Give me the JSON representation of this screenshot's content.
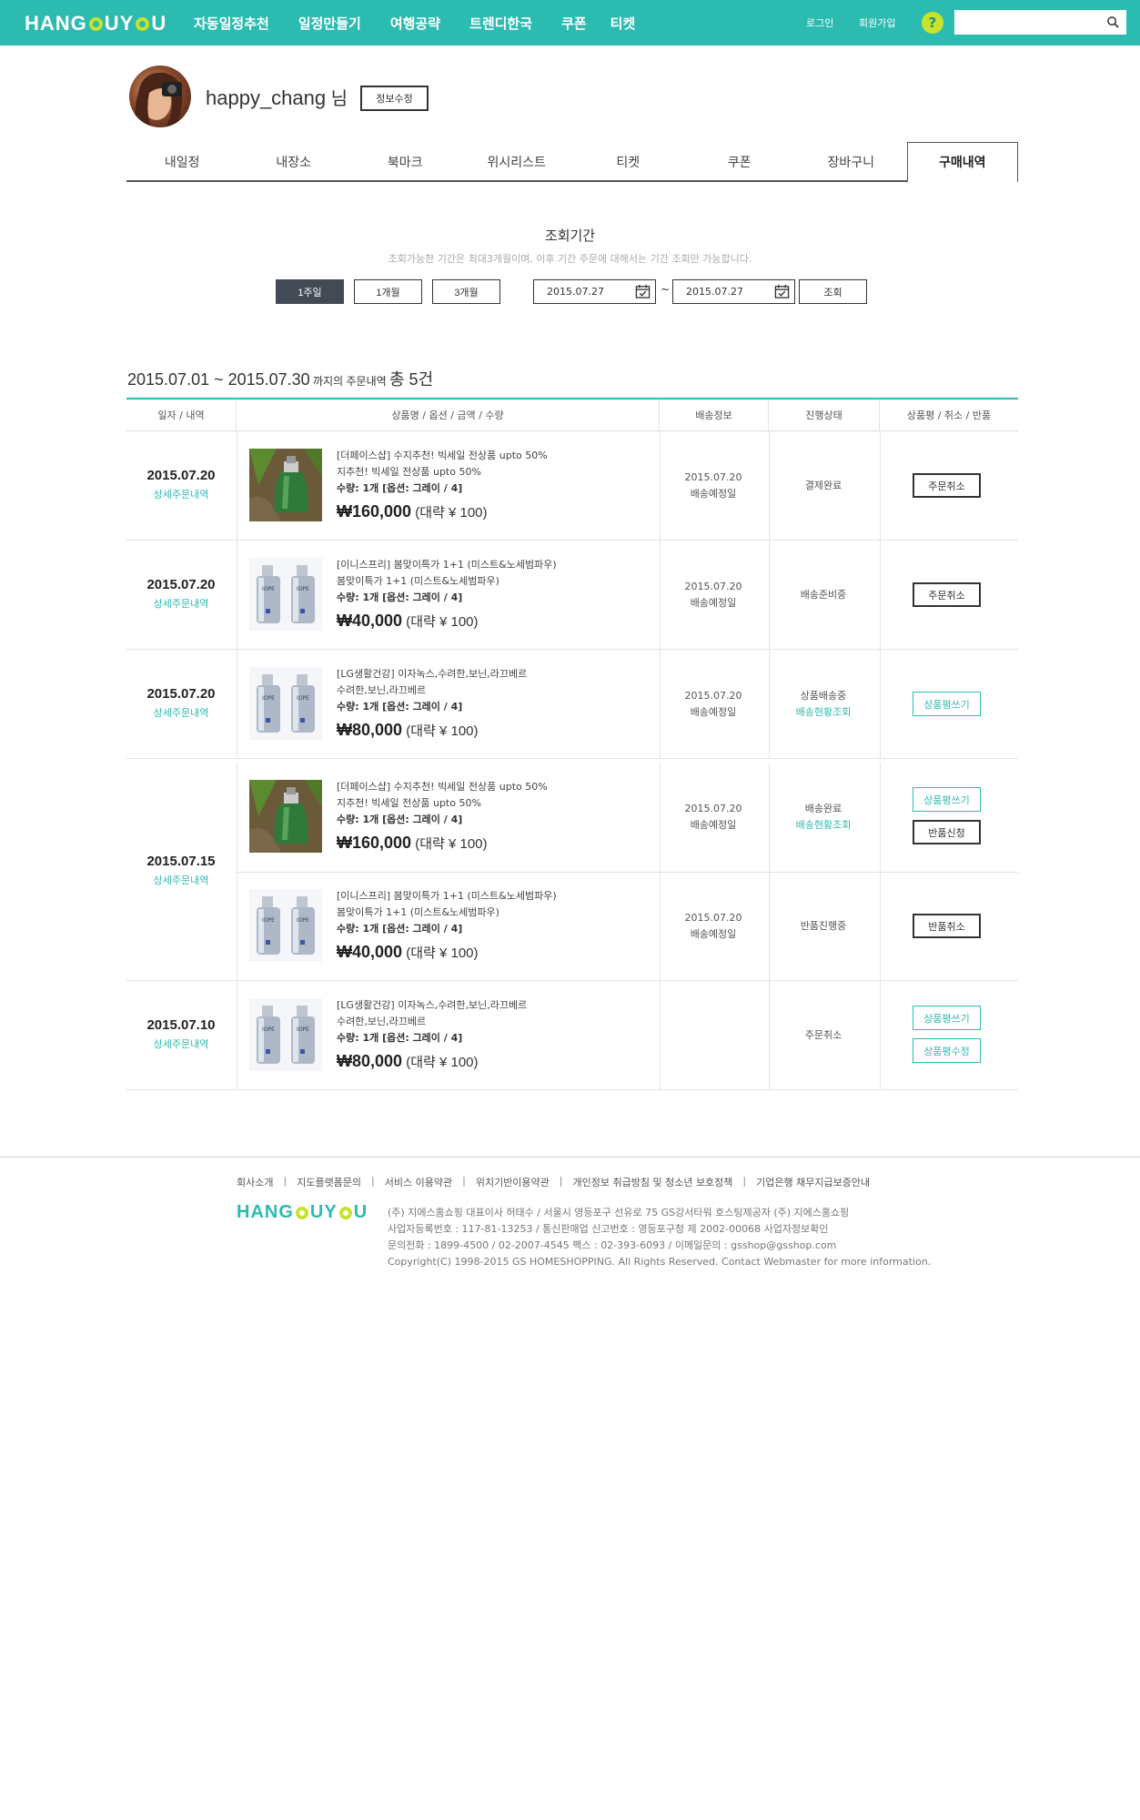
{
  "header": {
    "logo_left": "HANG",
    "logo_right": "UY",
    "logo_end": "U",
    "nav": [
      "자동일정추천",
      "일정만들기",
      "여행공략",
      "트렌디한국",
      "쿠폰",
      "티켓"
    ],
    "login": "로그인",
    "join": "회원가입",
    "help": "?",
    "search_placeholder": ""
  },
  "profile": {
    "username": "happy_chang",
    "suffix": " 님",
    "edit_label": "정보수정"
  },
  "tabs": [
    "내일정",
    "내장소",
    "북마크",
    "위시리스트",
    "티켓",
    "쿠폰",
    "장바구니",
    "구매내역"
  ],
  "active_tab": 7,
  "period": {
    "title": "조회기간",
    "note": "조회가능한 기간은 최대3개월이며, 이후 기간 주문에 대해서는 기간 조회만 가능합니다.",
    "buttons": [
      "1주일",
      "1개월",
      "3개월"
    ],
    "selected": 0,
    "start_date": "2015.07.27",
    "end_date": "2015.07.27",
    "tilde": "~",
    "query_label": "조회"
  },
  "summary": {
    "range": "2015.07.01 ~ 2015.07.30",
    "middle": " 까지의 주문내역 ",
    "total": "총 5건"
  },
  "table": {
    "headers": [
      "일자 / 내역",
      "상품명 / 옵션 / 금액 / 수량",
      "배송정보",
      "진행상태",
      "상품평 / 취소 / 반품"
    ],
    "detail_link": "상세주문내역",
    "groups": [
      {
        "date": "2015.07.20",
        "items": [
          {
            "image": "green-bottle",
            "name1": "[더페이스샵] 수지추천! 빅세일 전상품 upto 50%",
            "name2": "지추천! 빅세일 전상품 upto 50%",
            "qty": "수량: 1개  [옵션: 그레이 / 4]",
            "price": "₩160,000",
            "price_sub": " (대략 ¥ 100)",
            "ship_date": "2015.07.20",
            "ship_label": "배송예정일",
            "status": "결제완료",
            "status_link": "",
            "actions": [
              {
                "label": "주문취소",
                "style": "dark"
              }
            ]
          }
        ]
      },
      {
        "date": "2015.07.20",
        "items": [
          {
            "image": "silver-bottles",
            "name1": "[이니스프리] 봄맞이특가 1+1 (미스트&노세범파우)",
            "name2": "봄맞이특가 1+1 (미스트&노세범파우)",
            "qty": "수량: 1개  [옵션: 그레이 / 4]",
            "price": "₩40,000",
            "price_sub": " (대략 ¥ 100)",
            "ship_date": "2015.07.20",
            "ship_label": "배송예정일",
            "status": "배송준비중",
            "status_link": "",
            "actions": [
              {
                "label": "주문취소",
                "style": "dark"
              }
            ]
          }
        ]
      },
      {
        "date": "2015.07.20",
        "items": [
          {
            "image": "silver-bottles",
            "name1": "[LG생활건강] 이자녹스,수려한,보닌,라끄베르",
            "name2": "수려한,보닌,라끄베르",
            "qty": "수량: 1개  [옵션: 그레이 / 4]",
            "price": "₩80,000",
            "price_sub": " (대략 ¥ 100)",
            "ship_date": "2015.07.20",
            "ship_label": "배송예정일",
            "status": "상품배송중",
            "status_link": "배송현황조회",
            "actions": [
              {
                "label": "상품평쓰기",
                "style": "teal"
              }
            ]
          }
        ]
      },
      {
        "date": "2015.07.15",
        "items": [
          {
            "image": "green-bottle",
            "name1": "[더페이스샵] 수지추천! 빅세일 전상품 upto 50%",
            "name2": "지추천! 빅세일 전상품 upto 50%",
            "qty": "수량: 1개  [옵션: 그레이 / 4]",
            "price": "₩160,000",
            "price_sub": " (대략 ¥ 100)",
            "ship_date": "2015.07.20",
            "ship_label": "배송예정일",
            "status": "배송완료",
            "status_link": "배송현황조회",
            "actions": [
              {
                "label": "상품평쓰기",
                "style": "teal"
              },
              {
                "label": "반품신청",
                "style": "dark"
              }
            ]
          },
          {
            "image": "silver-bottles",
            "name1": "[이니스프리] 봄맞이특가 1+1 (미스트&노세범파우)",
            "name2": "봄맞이특가 1+1 (미스트&노세범파우)",
            "qty": "수량: 1개  [옵션: 그레이 / 4]",
            "price": "₩40,000",
            "price_sub": " (대략 ¥ 100)",
            "ship_date": "2015.07.20",
            "ship_label": "배송예정일",
            "status": "반품진행중",
            "status_link": "",
            "actions": [
              {
                "label": "반품취소",
                "style": "dark"
              }
            ]
          }
        ]
      },
      {
        "date": "2015.07.10",
        "items": [
          {
            "image": "silver-bottles",
            "name1": "[LG생활건강] 이자녹스,수려한,보닌,라끄베르",
            "name2": "수려한,보닌,라끄베르",
            "qty": "수량: 1개  [옵션: 그레이 / 4]",
            "price": "₩80,000",
            "price_sub": " (대략 ¥ 100)",
            "ship_date": "",
            "ship_label": "",
            "status": "주문취소",
            "status_link": "",
            "actions": [
              {
                "label": "상품평쓰기",
                "style": "teal"
              },
              {
                "label": "상품평수정",
                "style": "teal"
              }
            ]
          }
        ]
      }
    ]
  },
  "footer": {
    "links": [
      "회사소개",
      "지도플랫폼문의",
      "서비스 이용약관",
      "위치기반이용약관",
      "개인정보 취급방침 및 청소년 보호정책",
      "기업은행 채무지급보증안내"
    ],
    "separator": "|",
    "info": [
      "(주) 지에스홈쇼핑 대표이사 허태수 / 서울시 영등포구 선유로 75 GS강서타워 호스팅제공자 (주) 지에스홈쇼핑",
      "사업자등록번호 : 117-81-13253 / 통신판매업 신고번호 : 영등포구청 제 2002-00068 사업자정보확인",
      "문의전화 : 1899-4500 / 02-2007-4545 팩스 : 02-393-6093 / 이메일문의 : gsshop@gsshop.com",
      "Copyright(C) 1998-2015 GS HOMESHOPPING. All Rights Reserved. Contact Webmaster for more information."
    ]
  },
  "colors": {
    "brand": "#2cbbb0",
    "accent": "#c7e32b",
    "dark_button": "#434a55"
  }
}
